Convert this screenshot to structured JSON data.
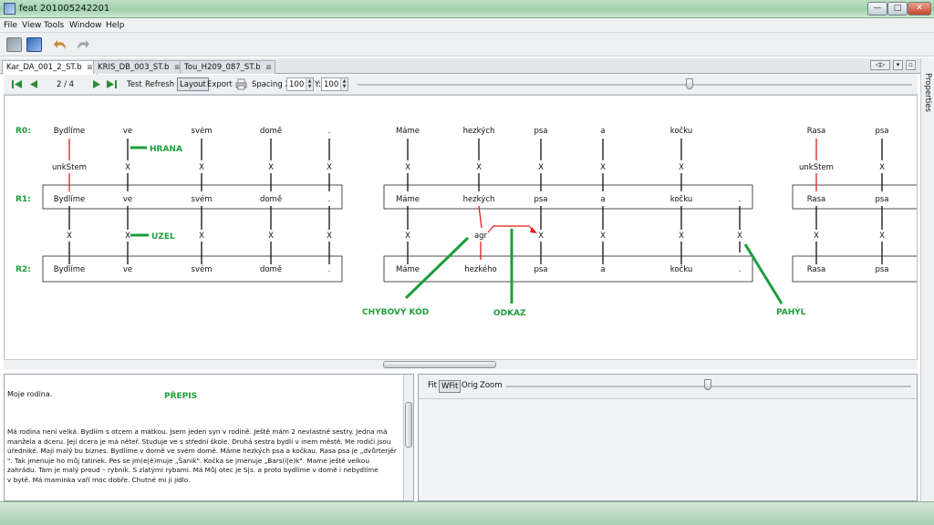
{
  "window": {
    "title": "feat 201005242201",
    "min": "—",
    "max": "□",
    "close": "✕"
  },
  "menu": [
    "File",
    "View",
    "Tools",
    "Window",
    "Help"
  ],
  "tabs": [
    {
      "label": "Kar_DA_001_2_ST.b",
      "active": true
    },
    {
      "label": "KRIS_DB_003_ST.b",
      "active": false
    },
    {
      "label": "Tou_H209_087_ST.b",
      "active": false
    }
  ],
  "tab_close": "⊠",
  "properties_label": "Properties",
  "nav": {
    "page": "2 / 4",
    "test": "Test",
    "refresh": "Refresh",
    "layout": "Layout",
    "export": "Export",
    "spacing_x_label": "Spacing X:",
    "spacing_x": "100",
    "y_label": "Y:",
    "y": "100"
  },
  "rows": {
    "r0_label": "R0:",
    "r1_label": "R1:",
    "r2_label": "R2:"
  },
  "sentences": {
    "s1_r0": [
      "Bydlíme",
      "ve",
      "svém",
      "domě",
      "."
    ],
    "s1_r1": [
      "Bydlíme",
      "ve",
      "svém",
      "domě",
      "."
    ],
    "s1_r2": [
      "Bydlíme",
      "ve",
      "svém",
      "domě",
      "."
    ],
    "s1_mid": [
      "unkStem",
      "X",
      "X",
      "X",
      "X"
    ],
    "s1_low": [
      "X",
      "X",
      "X",
      "X",
      "X"
    ],
    "s2_r0": [
      "Máme",
      "hezkých",
      "psa",
      "a",
      "kočku"
    ],
    "s2_r1": [
      "Máme",
      "hezkých",
      "psa",
      "a",
      "kočku",
      "."
    ],
    "s2_r2": [
      "Máme",
      "hezkého",
      "psa",
      "a",
      "kočku",
      "."
    ],
    "s2_mid": [
      "X",
      "X",
      "X",
      "X",
      "X"
    ],
    "s2_low": [
      "X",
      "agr",
      "X",
      "X",
      "X",
      "X"
    ],
    "s3_r0": [
      "Rasa",
      "psa"
    ],
    "s3_r1": [
      "Rasa",
      "psa"
    ],
    "s3_r2": [
      "Rasa",
      "psa"
    ],
    "s3_mid": [
      "unkStem",
      "X"
    ],
    "s3_low": [
      "X",
      "X"
    ]
  },
  "annotations": {
    "hrana": "HRANA",
    "uzel": "UZEL",
    "chybovy_kod": "CHYBOVÝ KÓD",
    "odkaz": "ODKAZ",
    "pahyl": "PAHÝL",
    "prepis": "PŘEPIS"
  },
  "transcript": {
    "title": "Moje rodina.",
    "lines": [
      "Má rodina není velká.  Bydlím s otcem a mátkou.  Jsem jeden syn v rodině.  Ještě mám 2 nevlastné sestry.  Jedna má",
      "manžela a dceru.  Její dcera je má něteř.  Studuje ve s střední škole.  Druhá sestra bydlí v inem městě.  Me rodiči jsou",
      "úředniké.  Mají malý bu biznes.  Bydlíme v domě ve svém domě.  Máme hezkých psa a kočkau.  Rasa psa je „dvůrterjěr",
      "\".  Tak jmenuje ho můj tatinek. Pes se jm(e|ě)muje „Šaník\".  Kočka se jmenuje „Bars(i|e)k\".  Mame ještě velkou",
      "zahrádu.  Tam je malý proud – rybník.  S zlatými rybami.  Má Můj otec je S|s. a proto bydlíme v domě i nebydlíme",
      "v bytě.  Má maminka vaří moc dobře.  Chutné mi ji jidlo."
    ]
  },
  "zoom": {
    "fit": "Fit",
    "wfit": "WFit",
    "orig": "Orig",
    "zoom": "Zoom"
  },
  "colors": {
    "accent_green": "#1e9d3a",
    "error_red": "#e01e1e"
  }
}
